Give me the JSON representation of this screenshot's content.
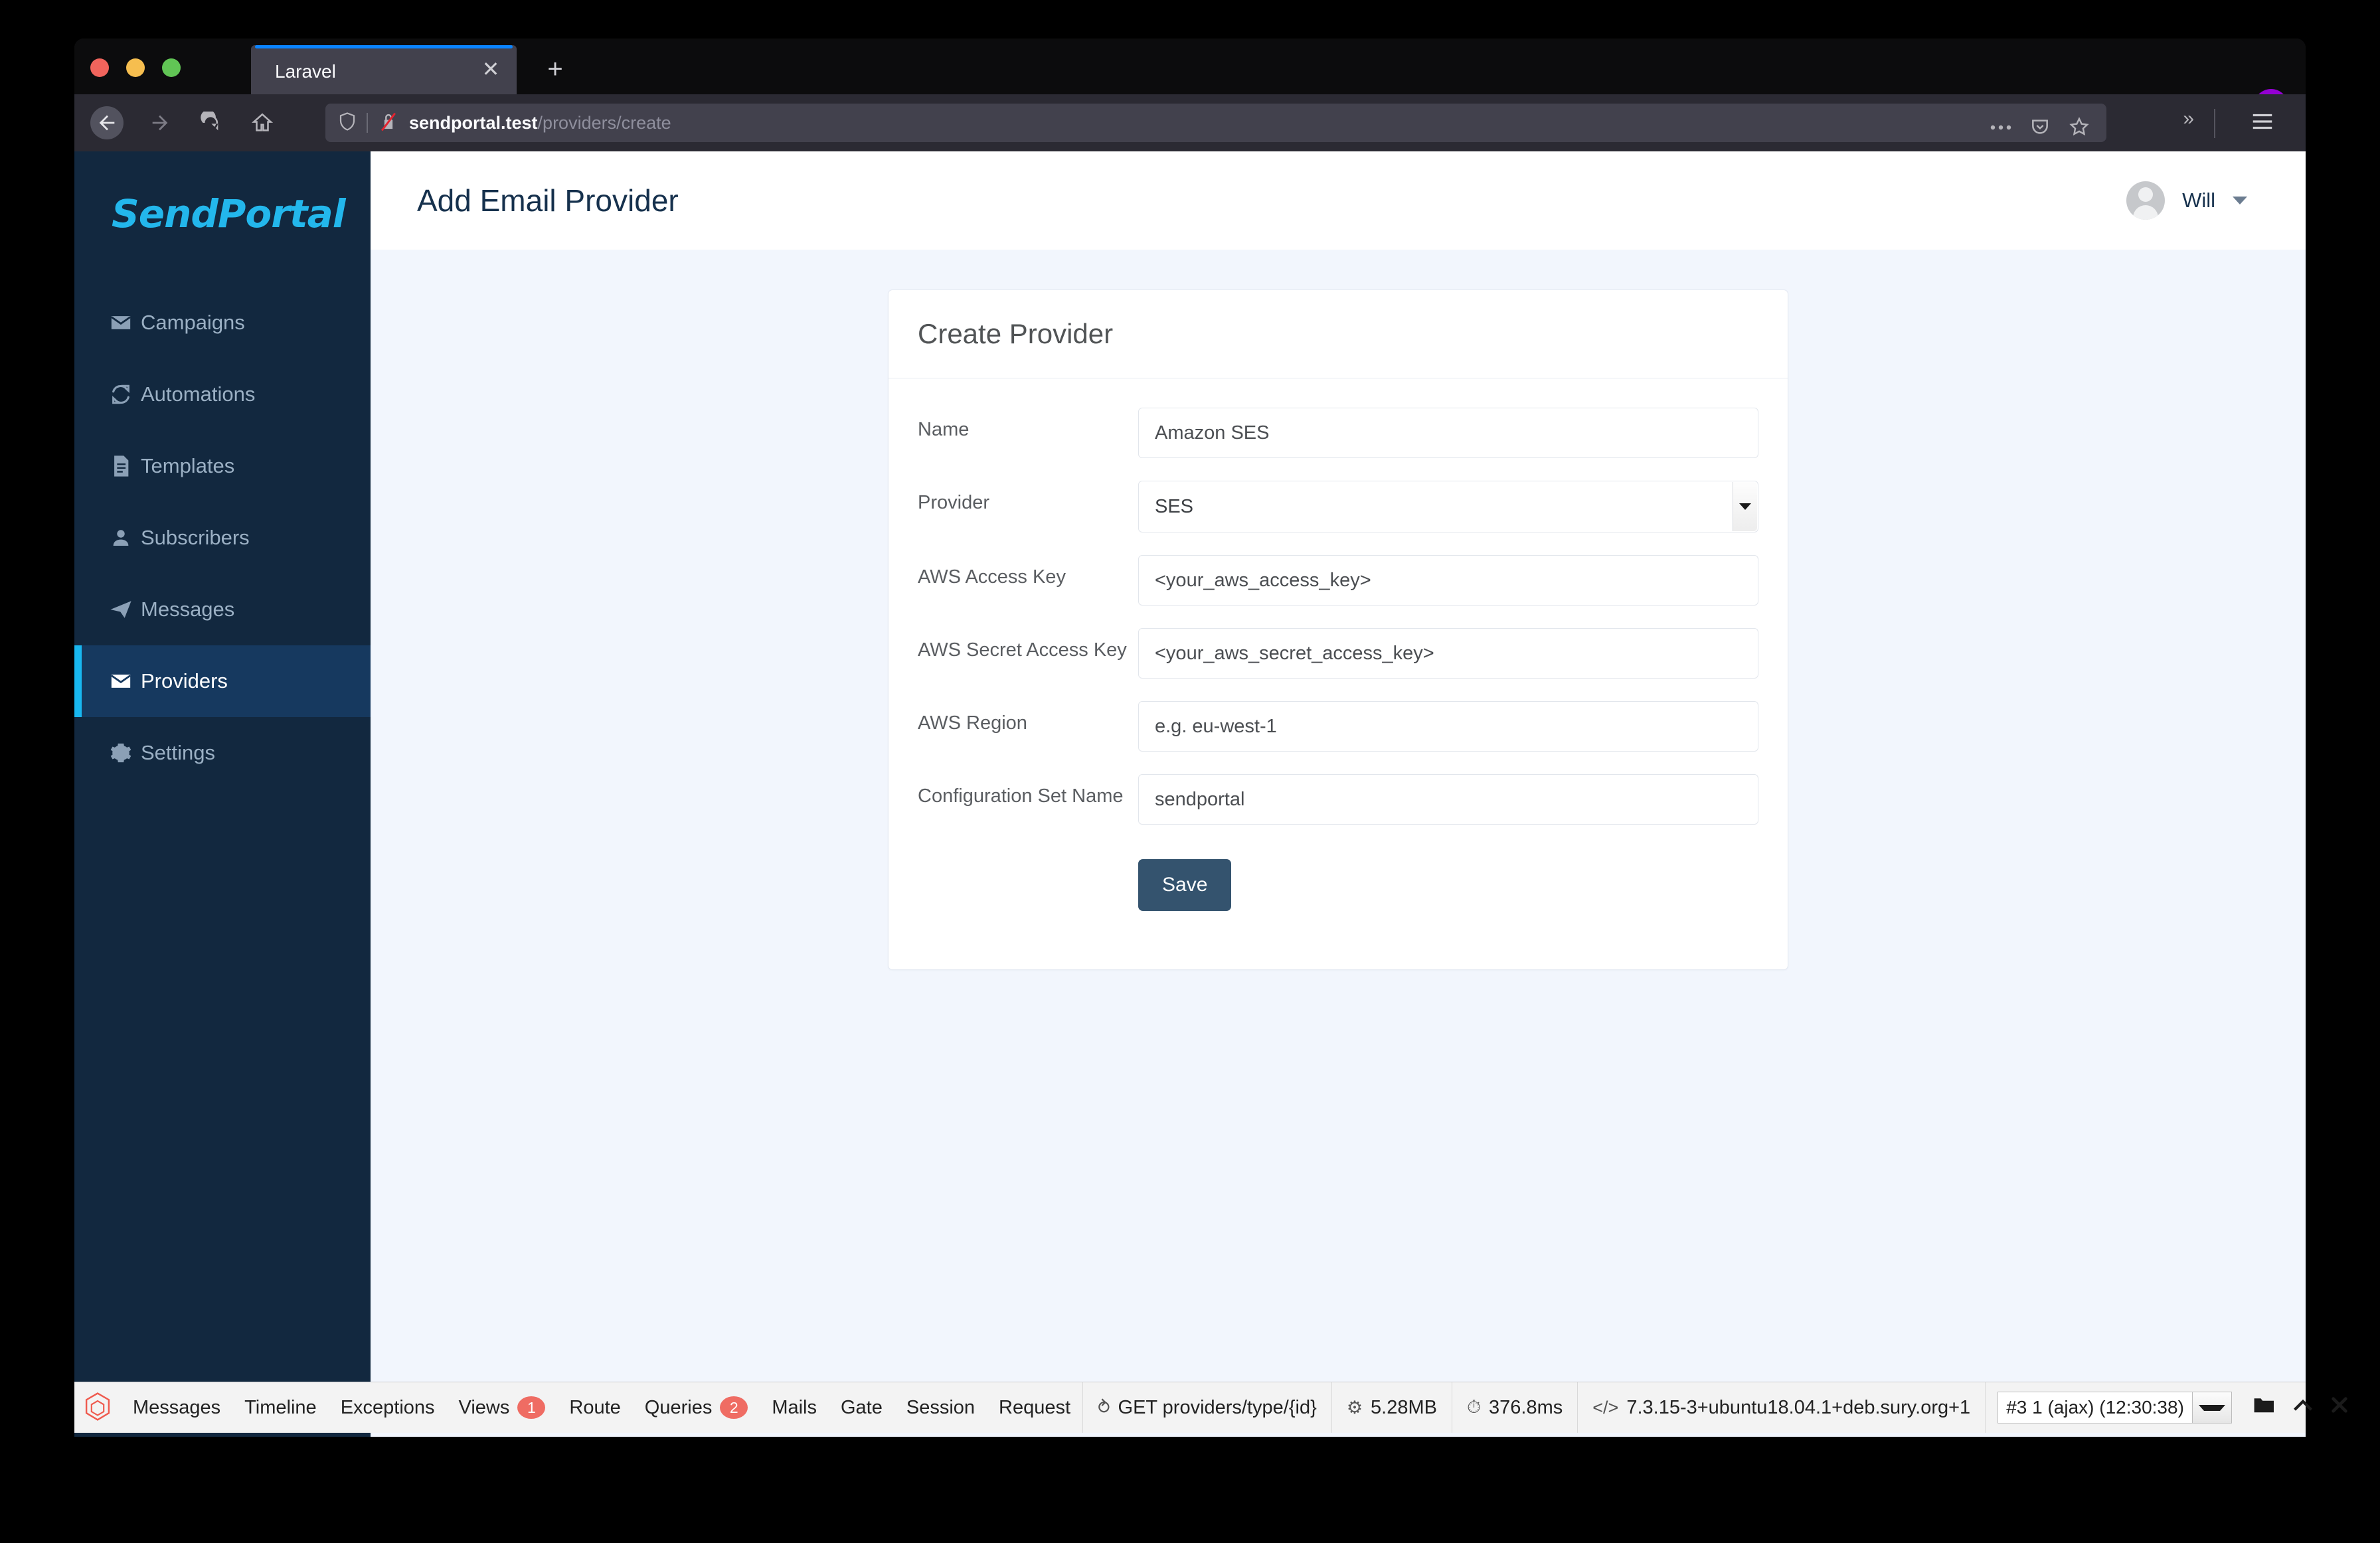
{
  "browser": {
    "tab": {
      "title": "Laravel",
      "close_icon": "close-icon",
      "new_tab_icon": "plus-icon"
    },
    "nav": {
      "back_icon": "back-arrow-icon",
      "forward_icon": "forward-arrow-icon",
      "reload_icon": "reload-icon",
      "home_icon": "home-icon"
    },
    "address": {
      "shield_icon": "shield-icon",
      "lock_icon": "insecure-lock-icon",
      "domain": "sendportal.test",
      "path": "/providers/create",
      "full_url": "sendportal.test/providers/create"
    },
    "toolbar": {
      "more_icon": "ellipsis-icon",
      "pocket_icon": "pocket-icon",
      "bookmark_icon": "star-icon",
      "overflow_icon": "double-chevron-icon",
      "menu_icon": "hamburger-menu-icon",
      "extension_icon": "mask-extension-icon",
      "extension_color": "#9400d3"
    }
  },
  "sidebar": {
    "logo": "SendPortal",
    "logo_color": "#23b7ec",
    "background": "#12283f",
    "active_background": "#16395f",
    "active_accent": "#18b7f0",
    "items": [
      {
        "label": "Campaigns",
        "icon": "envelope-icon",
        "active": false
      },
      {
        "label": "Automations",
        "icon": "refresh-icon",
        "active": false
      },
      {
        "label": "Templates",
        "icon": "document-icon",
        "active": false
      },
      {
        "label": "Subscribers",
        "icon": "user-icon",
        "active": false
      },
      {
        "label": "Messages",
        "icon": "paper-plane-icon",
        "active": false
      },
      {
        "label": "Providers",
        "icon": "envelope-icon",
        "active": true
      },
      {
        "label": "Settings",
        "icon": "gear-icon",
        "active": false
      }
    ]
  },
  "topbar": {
    "page_title": "Add Email Provider",
    "user_name": "Will",
    "avatar_icon": "avatar-icon",
    "caret_icon": "chevron-down-icon"
  },
  "form": {
    "card_title": "Create Provider",
    "fields": [
      {
        "label": "Name",
        "type": "text",
        "value": "Amazon SES",
        "placeholder": ""
      },
      {
        "label": "Provider",
        "type": "select",
        "value": "SES",
        "placeholder": ""
      },
      {
        "label": "AWS Access Key",
        "type": "text",
        "value": "",
        "placeholder": "<your_aws_access_key>"
      },
      {
        "label": "AWS Secret Access Key",
        "type": "text",
        "value": "",
        "placeholder": "<your_aws_secret_access_key>"
      },
      {
        "label": "AWS Region",
        "type": "text",
        "value": "",
        "placeholder": "e.g. eu-west-1"
      },
      {
        "label": "Configuration Set Name",
        "type": "text",
        "value": "",
        "placeholder": "sendportal"
      }
    ],
    "save_label": "Save",
    "save_color": "#34536e"
  },
  "debugbar": {
    "logo_icon": "laravel-logo-icon",
    "badge_color": "#ef6c63",
    "tabs": [
      {
        "label": "Messages",
        "badge": ""
      },
      {
        "label": "Timeline",
        "badge": ""
      },
      {
        "label": "Exceptions",
        "badge": ""
      },
      {
        "label": "Views",
        "badge": "1"
      },
      {
        "label": "Route",
        "badge": ""
      },
      {
        "label": "Queries",
        "badge": "2"
      },
      {
        "label": "Mails",
        "badge": ""
      },
      {
        "label": "Gate",
        "badge": ""
      },
      {
        "label": "Session",
        "badge": ""
      },
      {
        "label": "Request",
        "badge": ""
      }
    ],
    "stats": [
      {
        "icon": "route-arrow-icon",
        "text": "GET providers/type/{id}"
      },
      {
        "icon": "memory-icon",
        "text": "5.28MB"
      },
      {
        "icon": "clock-icon",
        "text": "376.8ms"
      },
      {
        "icon": "code-icon",
        "text": "7.3.15-3+ubuntu18.04.1+deb.sury.org+1"
      }
    ],
    "request_selector": "#3 1 (ajax) (12:30:38)",
    "controls": [
      {
        "icon": "folder-icon"
      },
      {
        "icon": "chevron-up-icon"
      },
      {
        "icon": "close-x-icon"
      }
    ]
  }
}
